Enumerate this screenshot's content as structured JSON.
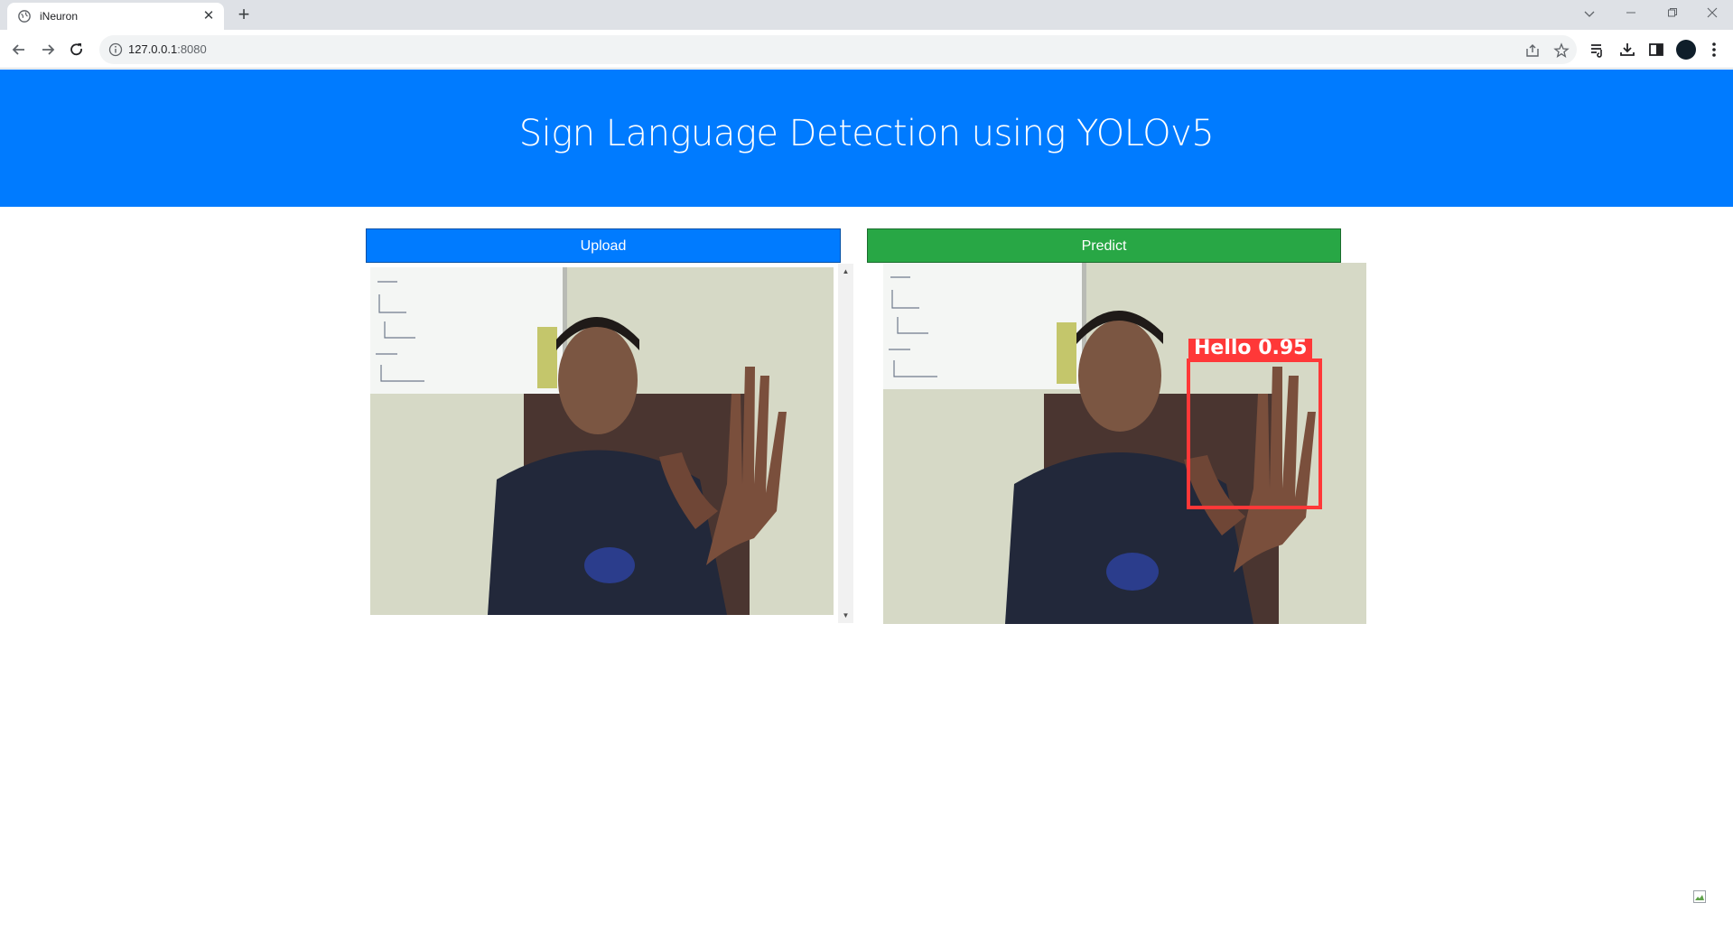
{
  "browser": {
    "tab_title": "iNeuron",
    "url_host": "127.0.0.1",
    "url_port": ":8080"
  },
  "page": {
    "title": "Sign Language Detection using YOLOv5",
    "upload_label": "Upload",
    "predict_label": "Predict"
  },
  "detection": {
    "label": "Hello",
    "confidence": "0.95",
    "box_color": "#ff3838"
  },
  "colors": {
    "primary": "#007bff",
    "success": "#28a745"
  }
}
